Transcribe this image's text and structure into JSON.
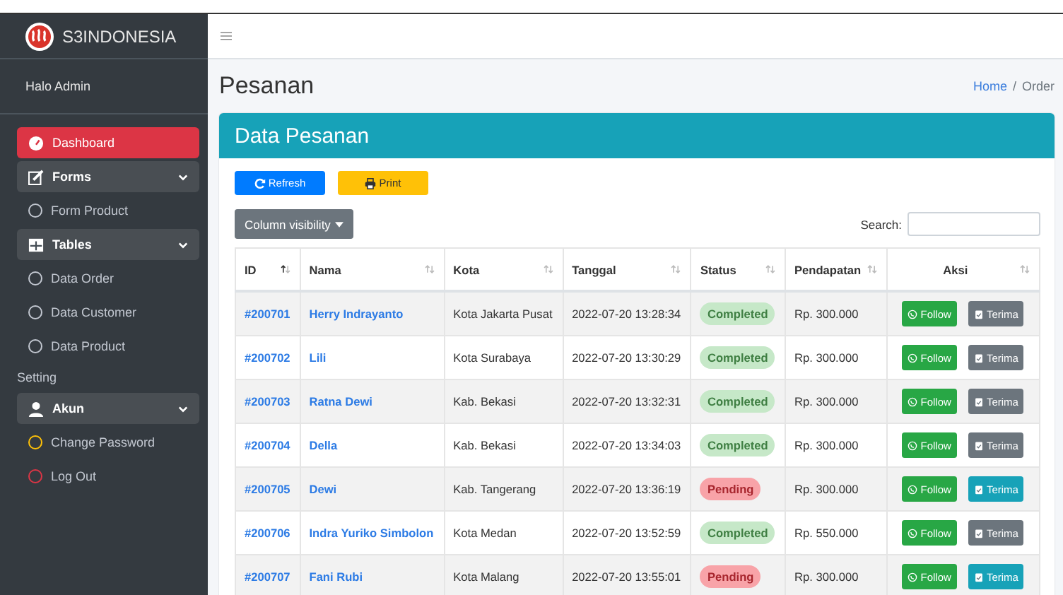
{
  "brand": {
    "name": "S3INDONESIA"
  },
  "sidebar": {
    "user": "Halo Admin",
    "items": [
      {
        "kind": "active",
        "label": "Dashboard"
      },
      {
        "kind": "group",
        "label": "Forms",
        "expanded": true
      },
      {
        "kind": "sub",
        "label": "Form Product",
        "color": "#c2c7d0"
      },
      {
        "kind": "group",
        "label": "Tables",
        "expanded": true
      },
      {
        "kind": "sub",
        "label": "Data Order",
        "color": "#c2c7d0"
      },
      {
        "kind": "sub",
        "label": "Data Customer",
        "color": "#c2c7d0"
      },
      {
        "kind": "sub",
        "label": "Data Product",
        "color": "#c2c7d0"
      },
      {
        "kind": "header",
        "label": "Setting"
      },
      {
        "kind": "group",
        "label": "Akun",
        "expanded": true
      },
      {
        "kind": "sub",
        "label": "Change Password",
        "color": "#ffc107"
      },
      {
        "kind": "sub",
        "label": "Log Out",
        "color": "#dc3545"
      }
    ]
  },
  "page": {
    "title": "Pesanan",
    "breadcrumb": [
      {
        "label": "Home",
        "kind": "link"
      },
      {
        "label": "/",
        "kind": "separator"
      },
      {
        "label": "Order",
        "kind": "current"
      }
    ]
  },
  "card": {
    "title": "Data Pesanan",
    "buttons": [
      {
        "label": "Refresh",
        "kind": "refresh"
      },
      {
        "label": "Print",
        "kind": "print"
      }
    ],
    "column_visibility": "Column visibility",
    "search_label": "Search:"
  },
  "table": {
    "columns": [
      {
        "label": "ID",
        "sorted": true
      },
      {
        "label": "Nama",
        "sorted": false
      },
      {
        "label": "Kota",
        "sorted": false
      },
      {
        "label": "Tanggal",
        "sorted": false
      },
      {
        "label": "Status",
        "sorted": false
      },
      {
        "label": "Pendapatan",
        "sorted": false
      },
      {
        "label": "Aksi",
        "sorted": false
      }
    ],
    "rows": [
      {
        "id": "#200701",
        "nama": "Herry Indrayanto",
        "kota": "Kota Jakarta Pusat",
        "tanggal": "2022-07-20 13:28:34",
        "status": {
          "label": "Completed",
          "kind": "completed"
        },
        "pendapatan": "Rp. 300.000",
        "follow": "Follow",
        "terima": "Terima"
      },
      {
        "id": "#200702",
        "nama": "Lili",
        "kota": "Kota Surabaya",
        "tanggal": "2022-07-20 13:30:29",
        "status": {
          "label": "Completed",
          "kind": "completed"
        },
        "pendapatan": "Rp. 300.000",
        "follow": "Follow",
        "terima": "Terima"
      },
      {
        "id": "#200703",
        "nama": "Ratna Dewi",
        "kota": "Kab. Bekasi",
        "tanggal": "2022-07-20 13:32:31",
        "status": {
          "label": "Completed",
          "kind": "completed"
        },
        "pendapatan": "Rp. 300.000",
        "follow": "Follow",
        "terima": "Terima"
      },
      {
        "id": "#200704",
        "nama": "Della",
        "kota": "Kab. Bekasi",
        "tanggal": "2022-07-20 13:34:03",
        "status": {
          "label": "Completed",
          "kind": "completed"
        },
        "pendapatan": "Rp. 300.000",
        "follow": "Follow",
        "terima": "Terima"
      },
      {
        "id": "#200705",
        "nama": "Dewi",
        "kota": "Kab. Tangerang",
        "tanggal": "2022-07-20 13:36:19",
        "status": {
          "label": "Pending",
          "kind": "pending"
        },
        "pendapatan": "Rp. 300.000",
        "follow": "Follow",
        "terima": "Terima"
      },
      {
        "id": "#200706",
        "nama": "Indra Yuriko Simbolon",
        "kota": "Kota Medan",
        "tanggal": "2022-07-20 13:52:59",
        "status": {
          "label": "Completed",
          "kind": "completed"
        },
        "pendapatan": "Rp. 550.000",
        "follow": "Follow",
        "terima": "Terima"
      },
      {
        "id": "#200707",
        "nama": "Fani Rubi",
        "kota": "Kota Malang",
        "tanggal": "2022-07-20 13:55:01",
        "status": {
          "label": "Pending",
          "kind": "pending"
        },
        "pendapatan": "Rp. 300.000",
        "follow": "Follow",
        "terima": "Terima"
      }
    ]
  }
}
